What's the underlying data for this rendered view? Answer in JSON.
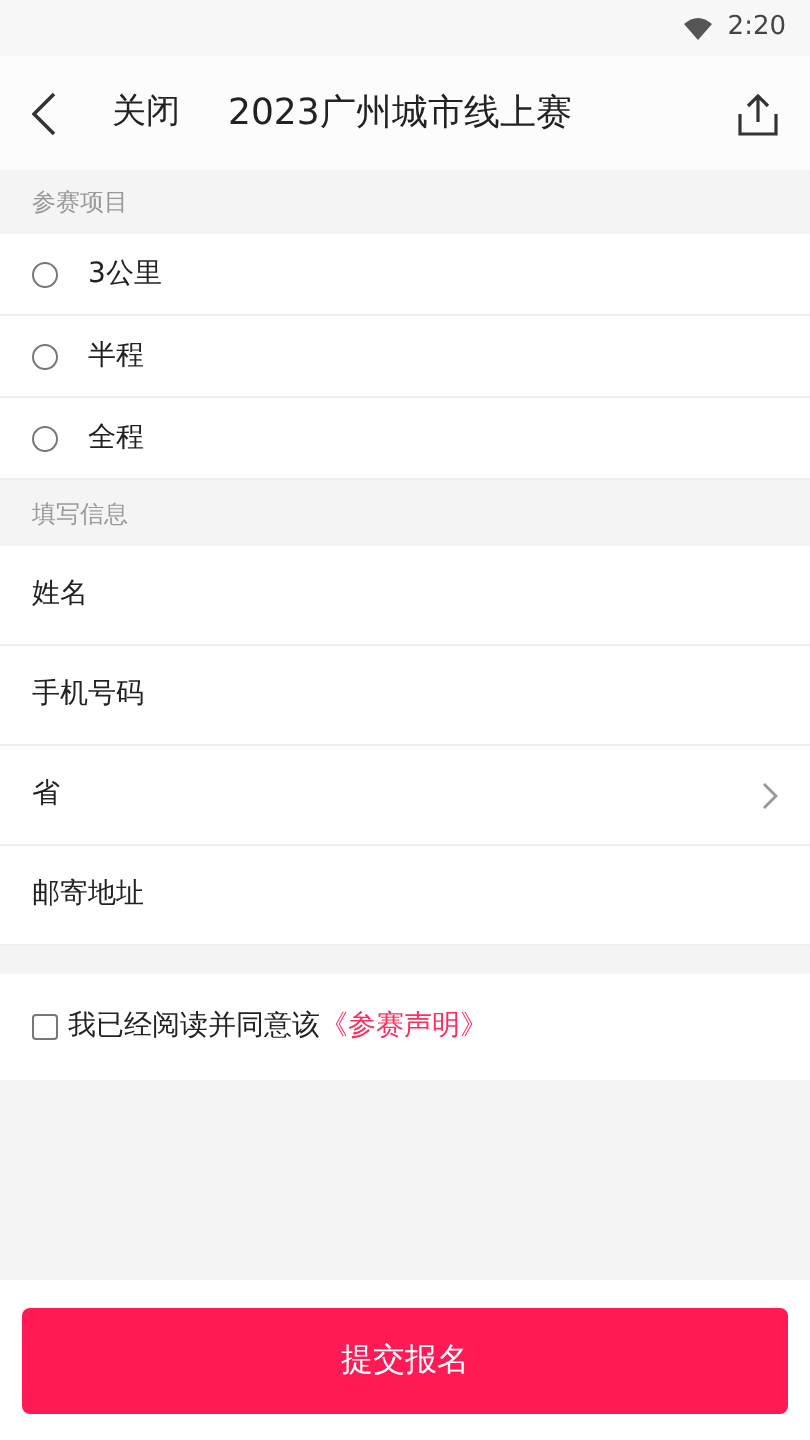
{
  "status_bar": {
    "time": "2:20"
  },
  "header": {
    "close": "关闭",
    "title": "2023广州城市线上赛"
  },
  "event_section": {
    "label": "参赛项目",
    "options": [
      {
        "label": "3公里",
        "selected": false
      },
      {
        "label": "半程",
        "selected": false
      },
      {
        "label": "全程",
        "selected": false
      }
    ]
  },
  "info_section": {
    "label": "填写信息",
    "fields": [
      {
        "kind": "text",
        "label": "姓名"
      },
      {
        "kind": "text",
        "label": "手机号码"
      },
      {
        "kind": "select",
        "label": "省"
      },
      {
        "kind": "text",
        "label": "邮寄地址"
      }
    ]
  },
  "agreement": {
    "checked": false,
    "text": "我已经阅读并同意该",
    "link": "《参赛声明》"
  },
  "submit": "提交报名"
}
